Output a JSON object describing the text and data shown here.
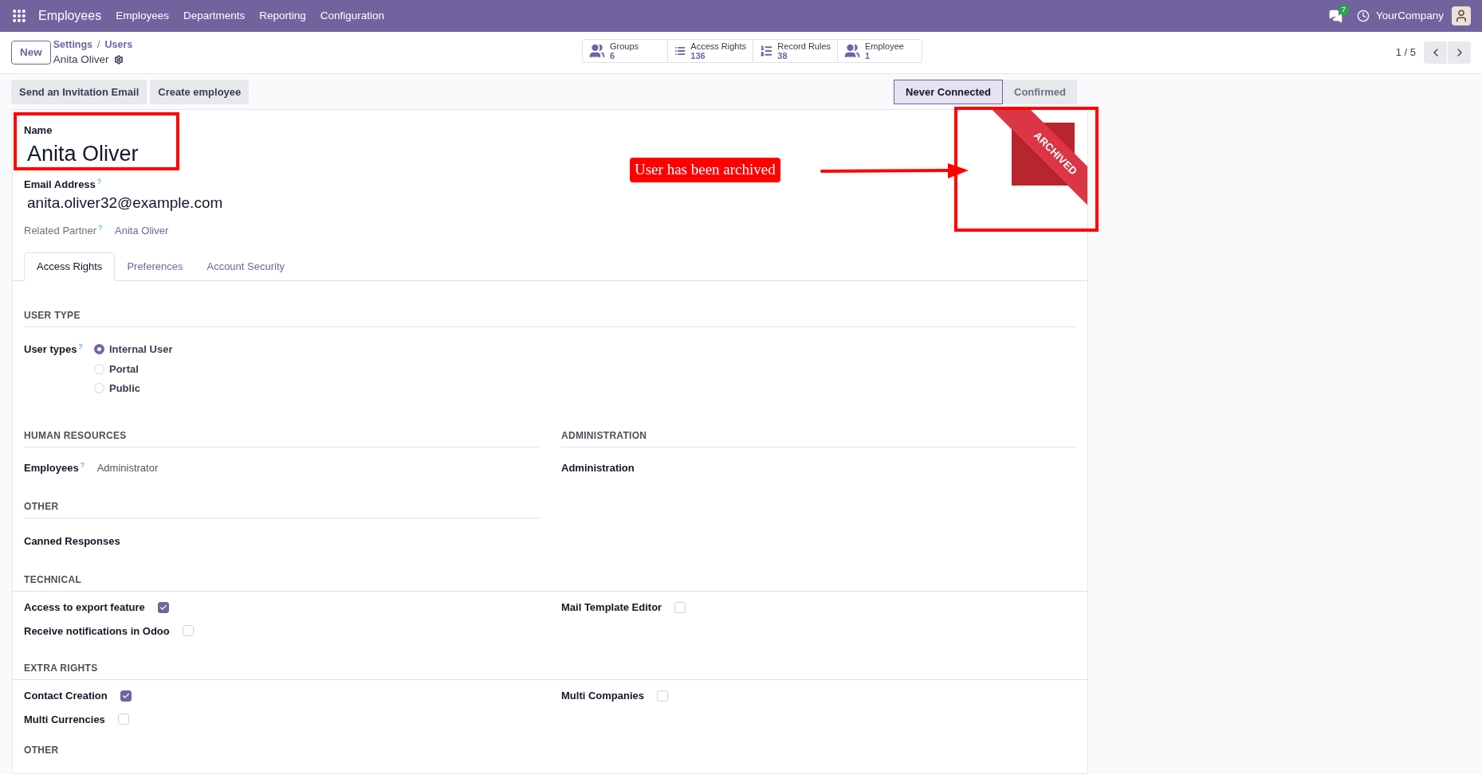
{
  "topbar": {
    "app_name": "Employees",
    "menu": [
      "Employees",
      "Departments",
      "Reporting",
      "Configuration"
    ],
    "messages_count": "7",
    "company": "YourCompany"
  },
  "control_panel": {
    "new_button": "New",
    "breadcrumb": [
      "Settings",
      "Users"
    ],
    "separator": "/",
    "record": "Anita Oliver",
    "pager": "1 / 5"
  },
  "smart_buttons": [
    {
      "kind": "people",
      "label": "Groups",
      "count": "6"
    },
    {
      "kind": "list",
      "label": "Access Rights",
      "count": "136"
    },
    {
      "kind": "bullets",
      "label": "Record Rules",
      "count": "38"
    },
    {
      "kind": "people",
      "label": "Employee",
      "count": "1"
    }
  ],
  "actions": [
    "Send an Invitation Email",
    "Create employee"
  ],
  "statusbar": [
    {
      "label": "Never Connected",
      "selected": true
    },
    {
      "label": "Confirmed",
      "selected": false
    }
  ],
  "form": {
    "name_label": "Name",
    "name": "Anita Oliver",
    "email_label": "Email Address",
    "email_help": "?",
    "email": "anita.oliver32@example.com",
    "partner_label": "Related Partner",
    "partner_help": "?",
    "partner": "Anita Oliver",
    "ribbon": "ARCHIVED"
  },
  "annotation": {
    "text": "User has been archived"
  },
  "tabs": [
    {
      "label": "Access Rights",
      "selected": true
    },
    {
      "label": "Preferences",
      "selected": false
    },
    {
      "label": "Account Security",
      "selected": false
    }
  ],
  "user_type": {
    "heading": "USER TYPE",
    "label": "User types",
    "help": "?",
    "options": [
      {
        "label": "Internal User",
        "selected": true
      },
      {
        "label": "Portal",
        "selected": false
      },
      {
        "label": "Public",
        "selected": false
      }
    ]
  },
  "columns": [
    {
      "heading": "HUMAN RESOURCES",
      "fields": [
        {
          "label": "Employees",
          "help": "?",
          "value": "Administrator"
        }
      ]
    },
    {
      "heading": "ADMINISTRATION",
      "fields": [
        {
          "label": "Administration"
        }
      ]
    }
  ],
  "other": {
    "heading": "OTHER",
    "fields": [
      {
        "label": "Canned Responses"
      }
    ]
  },
  "checkbox_sections": [
    {
      "heading": "TECHNICAL",
      "left": [
        {
          "label": "Access to export feature",
          "checked": true
        },
        {
          "label": "Receive notifications in Odoo",
          "checked": false
        }
      ],
      "right": [
        {
          "label": "Mail Template Editor",
          "checked": false
        }
      ]
    },
    {
      "heading": "EXTRA RIGHTS",
      "left": [
        {
          "label": "Contact Creation",
          "checked": true
        },
        {
          "label": "Multi Currencies",
          "checked": false
        }
      ],
      "right": [
        {
          "label": "Multi Companies",
          "checked": false
        }
      ]
    }
  ],
  "last_heading": "OTHER"
}
